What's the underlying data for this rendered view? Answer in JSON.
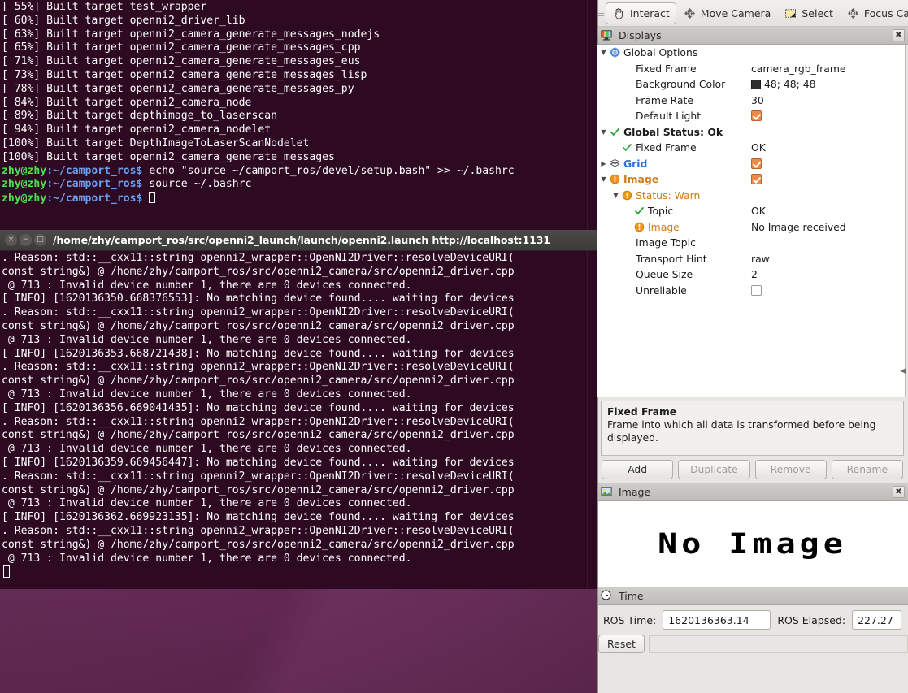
{
  "terminal1": {
    "lines": [
      "[ 55%] Built target test_wrapper",
      "[ 60%] Built target openni2_driver_lib",
      "[ 63%] Built target openni2_camera_generate_messages_nodejs",
      "[ 65%] Built target openni2_camera_generate_messages_cpp",
      "[ 71%] Built target openni2_camera_generate_messages_eus",
      "[ 73%] Built target openni2_camera_generate_messages_lisp",
      "[ 78%] Built target openni2_camera_generate_messages_py",
      "[ 84%] Built target openni2_camera_node",
      "[ 89%] Built target depthimage_to_laserscan",
      "[ 94%] Built target openni2_camera_nodelet",
      "[100%] Built target DepthImageToLaserScanNodelet",
      "[100%] Built target openni2_camera_generate_messages"
    ],
    "prompt_user": "zhy@zhy",
    "prompt_path": ":~/camport_ros$",
    "commands": [
      " echo \"source ~/camport_ros/devel/setup.bash\" >> ~/.bashrc",
      " source ~/.bashrc",
      " "
    ]
  },
  "terminal2": {
    "title": "/home/zhy/camport_ros/src/openni2_launch/launch/openni2.launch http://localhost:1131",
    "window_buttons": [
      "×",
      "−",
      "□"
    ],
    "lines": [
      ". Reason: std::__cxx11::string openni2_wrapper::OpenNI2Driver::resolveDeviceURI(",
      "const string&) @ /home/zhy/camport_ros/src/openni2_camera/src/openni2_driver.cpp",
      " @ 713 : Invalid device number 1, there are 0 devices connected.",
      "[ INFO] [1620136350.668376553]: No matching device found.... waiting for devices",
      ". Reason: std::__cxx11::string openni2_wrapper::OpenNI2Driver::resolveDeviceURI(",
      "const string&) @ /home/zhy/camport_ros/src/openni2_camera/src/openni2_driver.cpp",
      " @ 713 : Invalid device number 1, there are 0 devices connected.",
      "[ INFO] [1620136353.668721438]: No matching device found.... waiting for devices",
      ". Reason: std::__cxx11::string openni2_wrapper::OpenNI2Driver::resolveDeviceURI(",
      "const string&) @ /home/zhy/camport_ros/src/openni2_camera/src/openni2_driver.cpp",
      " @ 713 : Invalid device number 1, there are 0 devices connected.",
      "[ INFO] [1620136356.669041435]: No matching device found.... waiting for devices",
      ". Reason: std::__cxx11::string openni2_wrapper::OpenNI2Driver::resolveDeviceURI(",
      "const string&) @ /home/zhy/camport_ros/src/openni2_camera/src/openni2_driver.cpp",
      " @ 713 : Invalid device number 1, there are 0 devices connected.",
      "[ INFO] [1620136359.669456447]: No matching device found.... waiting for devices",
      ". Reason: std::__cxx11::string openni2_wrapper::OpenNI2Driver::resolveDeviceURI(",
      "const string&) @ /home/zhy/camport_ros/src/openni2_camera/src/openni2_driver.cpp",
      " @ 713 : Invalid device number 1, there are 0 devices connected.",
      "[ INFO] [1620136362.669923135]: No matching device found.... waiting for devices",
      ". Reason: std::__cxx11::string openni2_wrapper::OpenNI2Driver::resolveDeviceURI(",
      "const string&) @ /home/zhy/camport_ros/src/openni2_camera/src/openni2_driver.cpp",
      " @ 713 : Invalid device number 1, there are 0 devices connected."
    ]
  },
  "rviz": {
    "toolbar": [
      {
        "label": "Interact",
        "icon": "hand-icon",
        "active": true
      },
      {
        "label": "Move Camera",
        "icon": "move-camera-icon",
        "active": false
      },
      {
        "label": "Select",
        "icon": "select-rect-icon",
        "active": false
      },
      {
        "label": "Focus Camera",
        "icon": "focus-camera-icon",
        "active": false
      }
    ],
    "displays_panel": {
      "title": "Displays",
      "icon": "display-monitor-icon",
      "close": "✖",
      "rows": [
        {
          "indent": 0,
          "arrow": "▼",
          "status": "gear",
          "label": "Global Options",
          "value": "",
          "bold": false,
          "color": "dark"
        },
        {
          "indent": 1,
          "arrow": "",
          "status": "",
          "label": "Fixed Frame",
          "value": "camera_rgb_frame",
          "bold": false,
          "color": "dark"
        },
        {
          "indent": 1,
          "arrow": "",
          "status": "",
          "label": "Background Color",
          "value": "48; 48; 48",
          "swatch": "#303030",
          "bold": false,
          "color": "dark"
        },
        {
          "indent": 1,
          "arrow": "",
          "status": "",
          "label": "Frame Rate",
          "value": "30",
          "bold": false,
          "color": "dark"
        },
        {
          "indent": 1,
          "arrow": "",
          "status": "",
          "label": "Default Light",
          "value": "",
          "checkbox": "on",
          "bold": false,
          "color": "dark"
        },
        {
          "indent": 0,
          "arrow": "▼",
          "status": "check",
          "label": "Global Status: Ok",
          "value": "",
          "bold": true,
          "color": "dark"
        },
        {
          "indent": 1,
          "arrow": "",
          "status": "check",
          "label": "Fixed Frame",
          "value": "OK",
          "bold": false,
          "color": "dark"
        },
        {
          "indent": 0,
          "arrow": "▶",
          "status": "grid",
          "label": "Grid",
          "value": "",
          "checkbox": "on",
          "bold": true,
          "color": "blue"
        },
        {
          "indent": 0,
          "arrow": "▼",
          "status": "warn",
          "label": "Image",
          "value": "",
          "checkbox": "on",
          "bold": true,
          "color": "orange"
        },
        {
          "indent": 1,
          "arrow": "▼",
          "status": "warn",
          "label": "Status: Warn",
          "value": "",
          "bold": false,
          "color": "orange"
        },
        {
          "indent": 2,
          "arrow": "",
          "status": "check",
          "label": "Topic",
          "value": "OK",
          "bold": false,
          "color": "dark"
        },
        {
          "indent": 2,
          "arrow": "",
          "status": "warn",
          "label": "Image",
          "value": "No Image received",
          "bold": false,
          "color": "orange"
        },
        {
          "indent": 1,
          "arrow": "",
          "status": "",
          "label": "Image Topic",
          "value": "",
          "bold": false,
          "color": "dark"
        },
        {
          "indent": 1,
          "arrow": "",
          "status": "",
          "label": "Transport Hint",
          "value": "raw",
          "bold": false,
          "color": "dark"
        },
        {
          "indent": 1,
          "arrow": "",
          "status": "",
          "label": "Queue Size",
          "value": "2",
          "bold": false,
          "color": "dark"
        },
        {
          "indent": 1,
          "arrow": "",
          "status": "",
          "label": "Unreliable",
          "value": "",
          "checkbox": "off",
          "bold": false,
          "color": "dark"
        }
      ]
    },
    "description": {
      "title": "Fixed Frame",
      "text": "Frame into which all data is transformed before being displayed."
    },
    "buttons": [
      {
        "label": "Add",
        "enabled": true
      },
      {
        "label": "Duplicate",
        "enabled": false
      },
      {
        "label": "Remove",
        "enabled": false
      },
      {
        "label": "Rename",
        "enabled": false
      }
    ],
    "image_panel": {
      "title": "Image",
      "icon": "picture-icon",
      "close": "✖",
      "placeholder": "No Image"
    },
    "time_panel": {
      "title": "Time",
      "icon": "clock-icon",
      "ros_time_label": "ROS Time:",
      "ros_time_value": "1620136363.14",
      "ros_elapsed_label": "ROS Elapsed:",
      "ros_elapsed_value": "227.27",
      "reset_label": "Reset"
    },
    "collapse_handle": "◀"
  },
  "colors": {
    "terminal_bg": "#2d0922",
    "prompt_green": "#4ee04e",
    "prompt_blue": "#6a9ff0",
    "accent_orange": "#f08a4b",
    "status_blue": "#2a6fd6",
    "status_orange": "#d07a16",
    "desktop_purple": "#662a57"
  }
}
